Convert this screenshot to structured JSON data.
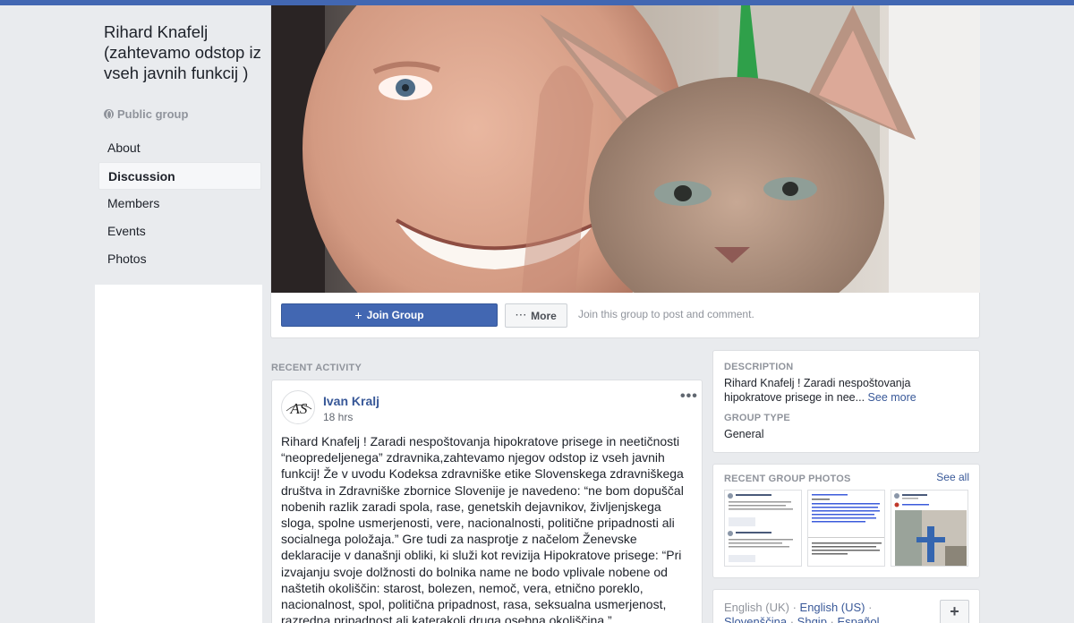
{
  "group": {
    "title": "Rihard Knafelj (zahtevamo odstop iz vseh javnih funkcij )",
    "privacy": "Public group"
  },
  "nav": {
    "items": [
      {
        "label": "About"
      },
      {
        "label": "Discussion"
      },
      {
        "label": "Members"
      },
      {
        "label": "Events"
      },
      {
        "label": "Photos"
      }
    ],
    "active": "Discussion"
  },
  "actions": {
    "join_label": "Join Group",
    "join_icon": "+",
    "more_label": "More",
    "more_icon": "···",
    "hint": "Join this group to post and comment."
  },
  "recent_activity": {
    "label": "RECENT ACTIVITY",
    "post": {
      "author": "Ivan Kralj",
      "time": "18 hrs",
      "avatar_text": "AS",
      "menu_icon": "•••",
      "text": "Rihard Knafelj ! Zaradi nespoštovanja hipokratove prisege in neetičnosti “neopredeljenega” zdravnika,zahtevamo njegov odstop iz vseh javnih funkcij! Že v uvodu Kodeksa zdravniške etike Slovenskega zdravniškega društva in Zdravniške zbornice Slovenije je navedeno: “ne bom dopuščal nobenih razlik zaradi spola, rase, genetskih dejavnikov, življenjskega sloga, spolne usmerjenosti, vere, nacionalnosti, politične pripadnosti ali socialnega položaja.” Gre tudi za nasprotje z načelom Ženevske deklaracije v današnji obliki, ki služi kot revizija Hipokratove prisege: “Pri izvajanju svoje dolžnosti do bolnika name ne bodo vplivale nobene od naštetih okoliščin: starost, bolezen, nemoč, vera, etnično poreklo, nacionalnost, spol, politična pripadnost, rasa, seksualna usmerjenost, razredna pripadnost ali katerakoli druga osebna okoliščina.”"
    }
  },
  "description": {
    "label": "DESCRIPTION",
    "text": "Rihard Knafelj ! Zaradi nespoštovanja hipokratove prisege in nee...",
    "see_more": "See more",
    "type_label": "GROUP TYPE",
    "type_value": "General"
  },
  "photos": {
    "label": "RECENT GROUP PHOTOS",
    "see_all": "See all"
  },
  "languages": {
    "items": [
      "English (UK)",
      "English (US)",
      "Slovenščina",
      "Shqip",
      "Español"
    ],
    "separator": " · ",
    "add_icon": "+"
  },
  "colors": {
    "brand": "#4267b2",
    "link": "#385898",
    "background": "#e9ebee"
  }
}
